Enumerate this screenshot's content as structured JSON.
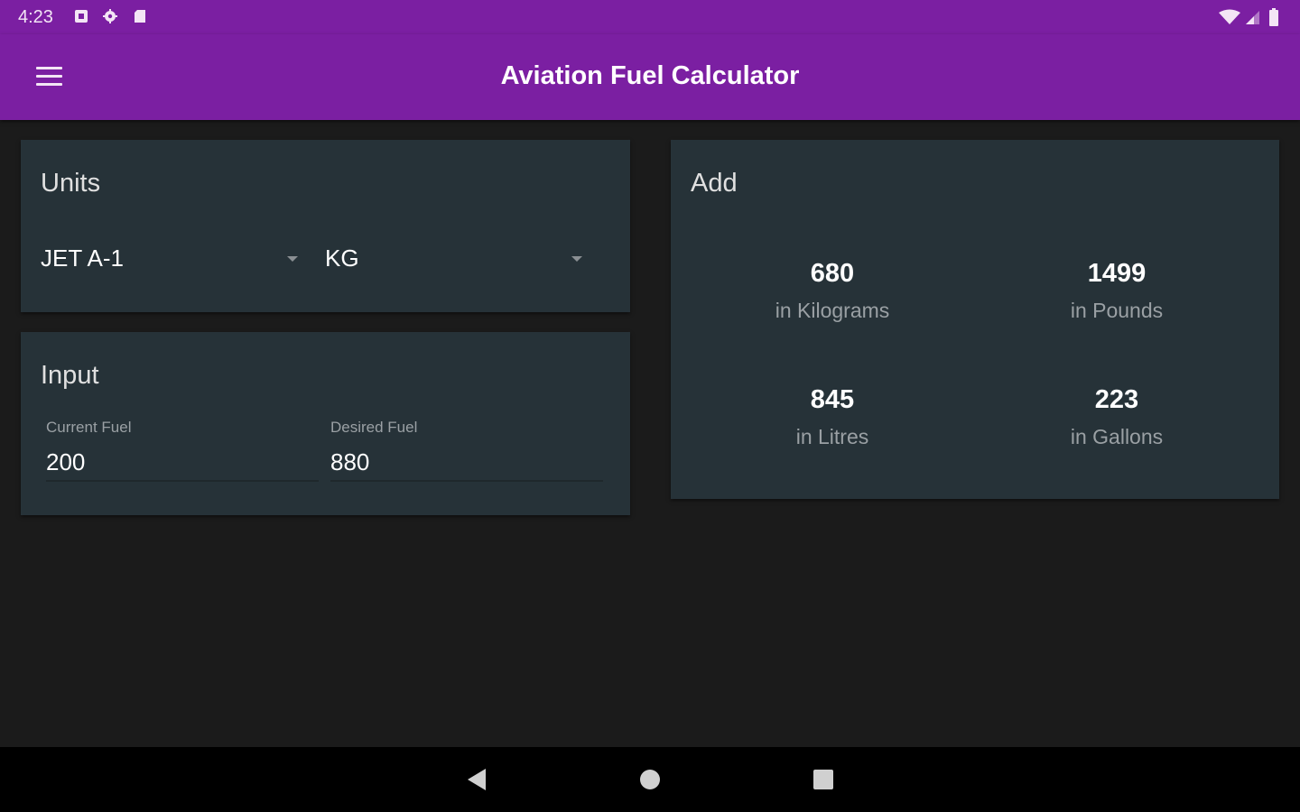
{
  "status_bar": {
    "time": "4:23",
    "left_icons": [
      "notification-box-icon",
      "settings-gear-icon",
      "sd-card-icon"
    ],
    "right_icons": [
      "wifi-icon",
      "cell-signal-icon",
      "battery-icon"
    ]
  },
  "app_bar": {
    "title": "Aviation Fuel Calculator",
    "menu_icon": "hamburger-menu-icon"
  },
  "units_card": {
    "title": "Units",
    "fuel_type_selected": "JET A-1",
    "unit_selected": "KG"
  },
  "input_card": {
    "title": "Input",
    "current_fuel_label": "Current Fuel",
    "current_fuel_value": "200",
    "desired_fuel_label": "Desired Fuel",
    "desired_fuel_value": "880"
  },
  "add_card": {
    "title": "Add",
    "results": [
      {
        "value": "680",
        "unit": "in Kilograms"
      },
      {
        "value": "1499",
        "unit": "in Pounds"
      },
      {
        "value": "845",
        "unit": "in Litres"
      },
      {
        "value": "223",
        "unit": "in Gallons"
      }
    ]
  },
  "nav_bar": {
    "icons": [
      "back-icon",
      "home-icon",
      "recents-icon"
    ]
  },
  "colors": {
    "primary": "#7b1fa2",
    "card": "#263238",
    "background": "#1b1b1b"
  }
}
